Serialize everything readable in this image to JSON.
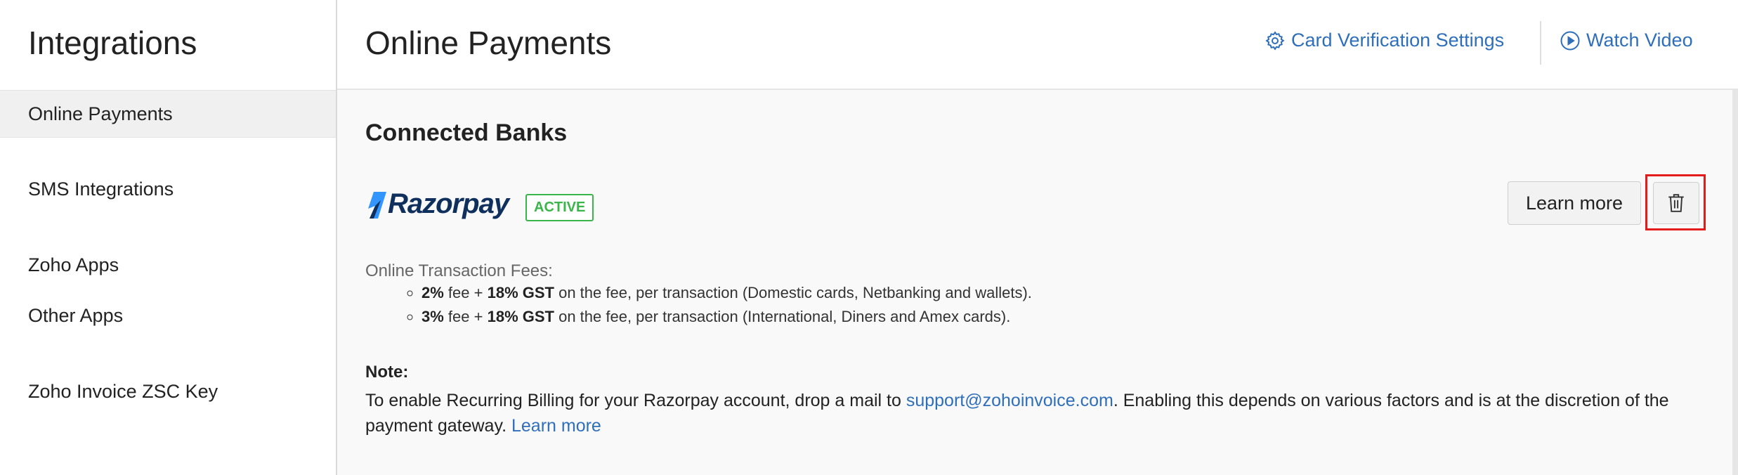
{
  "sidebar": {
    "title": "Integrations",
    "items": [
      {
        "label": "Online Payments"
      },
      {
        "label": "SMS Integrations"
      },
      {
        "label": "Zoho Apps"
      },
      {
        "label": "Other Apps"
      },
      {
        "label": "Zoho Invoice ZSC Key"
      }
    ]
  },
  "header": {
    "title": "Online Payments",
    "card_verification_label": "Card Verification Settings",
    "watch_video_label": "Watch Video"
  },
  "connected_banks": {
    "title": "Connected Banks",
    "gateway_name": "Razorpay",
    "status": "ACTIVE",
    "learn_more_button": "Learn more",
    "fees": {
      "label": "Online Transaction Fees:",
      "items": [
        {
          "rate": "2%",
          "fee_text": "fee +",
          "gst": "18% GST",
          "details": "on the fee, per transaction (Domestic cards, Netbanking and wallets)."
        },
        {
          "rate": "3%",
          "fee_text": "fee +",
          "gst": "18% GST",
          "details": "on the fee, per transaction (International, Diners and Amex cards)."
        }
      ]
    },
    "note": {
      "label": "Note:",
      "text_before": "To enable Recurring Billing for your Razorpay account, drop a mail to ",
      "email": "support@zohoinvoice.com",
      "text_after": ". Enabling this depends on various factors and is at the discretion of the payment gateway. ",
      "link": "Learn more"
    }
  },
  "colors": {
    "link": "#2f6fba",
    "active_badge": "#39b54a",
    "highlight": "#e31b1b",
    "razorpay_blue": "#3395ff",
    "razorpay_navy": "#0f2f5c"
  },
  "icons": {
    "card_verification": "gear-icon",
    "watch_video": "play-circle-icon",
    "delete": "trash-icon"
  }
}
